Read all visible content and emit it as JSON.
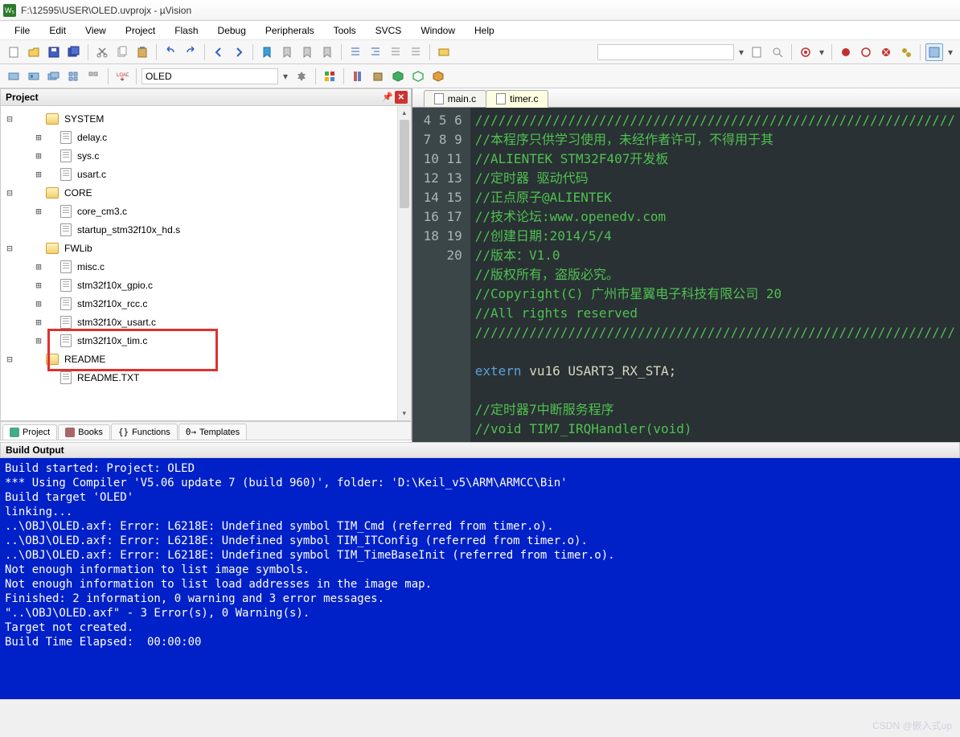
{
  "window": {
    "title": "F:\\12595\\USER\\OLED.uvprojx - µVision"
  },
  "menu": [
    "File",
    "Edit",
    "View",
    "Project",
    "Flash",
    "Debug",
    "Peripherals",
    "Tools",
    "SVCS",
    "Window",
    "Help"
  ],
  "toolbar2": {
    "target_name": "OLED"
  },
  "project_panel": {
    "title": "Project",
    "tree": {
      "groups": [
        {
          "name": "SYSTEM",
          "expanded": true,
          "files": [
            "delay.c",
            "sys.c",
            "usart.c"
          ]
        },
        {
          "name": "CORE",
          "expanded": true,
          "files": [
            "core_cm3.c",
            "startup_stm32f10x_hd.s"
          ]
        },
        {
          "name": "FWLib",
          "expanded": true,
          "files": [
            "misc.c",
            "stm32f10x_gpio.c",
            "stm32f10x_rcc.c",
            "stm32f10x_usart.c",
            "stm32f10x_tim.c"
          ]
        },
        {
          "name": "README",
          "expanded": true,
          "files": [
            "README.TXT"
          ]
        }
      ]
    },
    "tabs": [
      "Project",
      "Books",
      "Functions",
      "Templates"
    ]
  },
  "editor": {
    "tabs": [
      {
        "name": "main.c",
        "active": false
      },
      {
        "name": "timer.c",
        "active": true
      }
    ],
    "first_line": 4,
    "lines": [
      "//////////////////////////////////////////////////////////////",
      "//本程序只供学习使用，未经作者许可，不得用于其",
      "//ALIENTEK STM32F407开发板",
      "//定时器 驱动代码",
      "//正点原子@ALIENTEK",
      "//技术论坛:www.openedv.com",
      "//创建日期:2014/5/4",
      "//版本：V1.0",
      "//版权所有，盗版必究。",
      "//Copyright(C) 广州市星翼电子科技有限公司 20",
      "//All rights reserved",
      "//////////////////////////////////////////////////////////////",
      "",
      "extern vu16 USART3_RX_STA;",
      "",
      "//定时器7中断服务程序",
      "//void TIM7_IRQHandler(void)"
    ]
  },
  "build": {
    "title": "Build Output",
    "lines": [
      "Build started: Project: OLED",
      "*** Using Compiler 'V5.06 update 7 (build 960)', folder: 'D:\\Keil_v5\\ARM\\ARMCC\\Bin'",
      "Build target 'OLED'",
      "linking...",
      "..\\OBJ\\OLED.axf: Error: L6218E: Undefined symbol TIM_Cmd (referred from timer.o).",
      "..\\OBJ\\OLED.axf: Error: L6218E: Undefined symbol TIM_ITConfig (referred from timer.o).",
      "..\\OBJ\\OLED.axf: Error: L6218E: Undefined symbol TIM_TimeBaseInit (referred from timer.o).",
      "Not enough information to list image symbols.",
      "Not enough information to list load addresses in the image map.",
      "Finished: 2 information, 0 warning and 3 error messages.",
      "\"..\\OBJ\\OLED.axf\" - 3 Error(s), 0 Warning(s).",
      "Target not created.",
      "Build Time Elapsed:  00:00:00"
    ]
  },
  "watermark": "CSDN @嵌入式up"
}
